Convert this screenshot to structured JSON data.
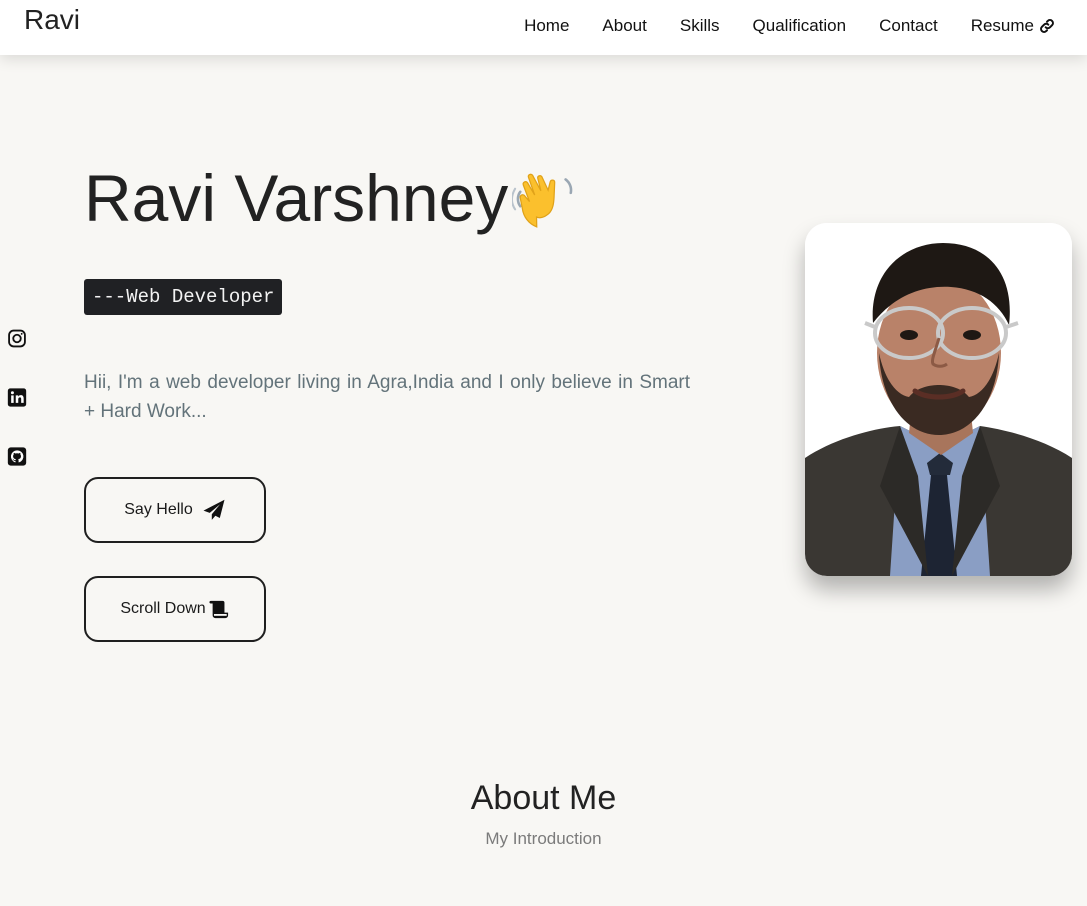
{
  "header": {
    "logo": "Ravi",
    "nav": [
      {
        "label": "Home"
      },
      {
        "label": "About"
      },
      {
        "label": "Skills"
      },
      {
        "label": "Qualification"
      },
      {
        "label": "Contact"
      },
      {
        "label": "Resume",
        "icon": "link-icon"
      }
    ]
  },
  "social": [
    {
      "icon": "instagram-icon"
    },
    {
      "icon": "linkedin-icon"
    },
    {
      "icon": "github-icon"
    }
  ],
  "hero": {
    "name": "Ravi Varshney",
    "name_icon": "waving-hand-icon",
    "role": "---Web Developer",
    "description": "Hii, I'm a web developer living in Agra,India and I only believe in Smart + Hard Work...",
    "say_hello_label": "Say Hello",
    "say_hello_icon": "paper-plane-icon",
    "scroll_down_label": "Scroll Down",
    "scroll_down_icon": "scroll-icon",
    "profile_photo": "profile-photo"
  },
  "about": {
    "title": "About Me",
    "subtitle": "My Introduction"
  },
  "colors": {
    "page_background": "#f8f7f4",
    "header_background": "#ffffff",
    "role_badge_background": "#202124",
    "description_text": "#63737a"
  }
}
